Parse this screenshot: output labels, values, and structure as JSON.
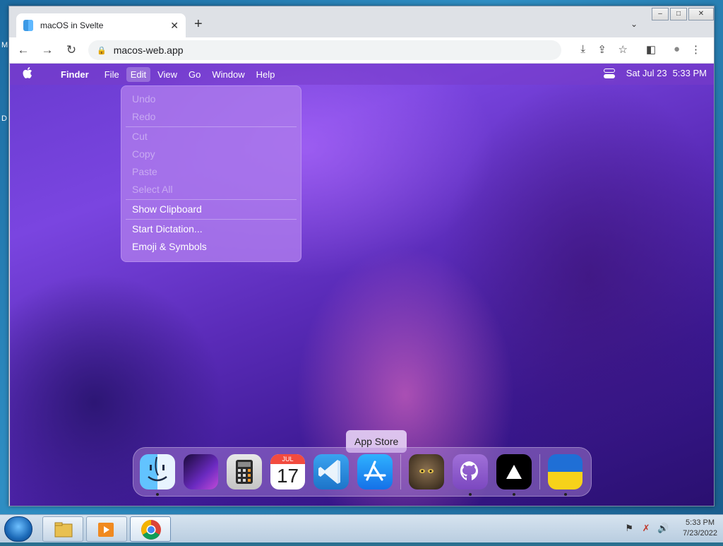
{
  "desktop": {
    "edge_labels": [
      "M",
      "D"
    ]
  },
  "browser": {
    "tab": {
      "title": "macOS in Svelte",
      "close_glyph": "✕"
    },
    "newtab_glyph": "+",
    "tab_search_glyph": "⌄",
    "window_controls": [
      "–",
      "□",
      "✕"
    ],
    "toolbar": {
      "back": "←",
      "forward": "→",
      "reload": "↻",
      "url": "macos-web.app",
      "install": "⤓",
      "share": "⇪",
      "bookmark": "☆",
      "sidepanel": "◧",
      "profile": "●",
      "menu": "⋮"
    }
  },
  "macos": {
    "menubar": {
      "apple": "",
      "items": [
        "Finder",
        "File",
        "Edit",
        "View",
        "Go",
        "Window",
        "Help"
      ],
      "active": "Edit",
      "date": "Sat Jul 23",
      "time": "5:33 PM"
    },
    "edit_menu": {
      "items": [
        {
          "label": "Undo",
          "disabled": true
        },
        {
          "label": "Redo",
          "disabled": true
        },
        {
          "sep": true
        },
        {
          "label": "Cut",
          "disabled": true
        },
        {
          "label": "Copy",
          "disabled": true
        },
        {
          "label": "Paste",
          "disabled": true
        },
        {
          "label": "Select All",
          "disabled": true
        },
        {
          "sep": true
        },
        {
          "label": "Show Clipboard",
          "disabled": false
        },
        {
          "sep": true
        },
        {
          "label": "Start Dictation...",
          "disabled": false
        },
        {
          "label": "Emoji & Symbols",
          "disabled": false
        }
      ]
    },
    "dock": {
      "tooltip": "App Store",
      "calendar": {
        "month": "JUL",
        "day": "17"
      },
      "apps": [
        {
          "id": "finder",
          "running": true
        },
        {
          "id": "wallpapers",
          "running": false
        },
        {
          "id": "calculator",
          "running": false
        },
        {
          "id": "calendar",
          "running": false
        },
        {
          "id": "vscode",
          "running": false
        },
        {
          "id": "app-store",
          "running": false
        },
        {
          "sep": true
        },
        {
          "id": "cat-photo",
          "running": false
        },
        {
          "id": "github",
          "running": true
        },
        {
          "id": "vercel",
          "running": true
        },
        {
          "sep": true
        },
        {
          "id": "ukraine",
          "running": true
        }
      ]
    }
  },
  "taskbar": {
    "clock": {
      "time": "5:33 PM",
      "date": "7/23/2022"
    }
  }
}
